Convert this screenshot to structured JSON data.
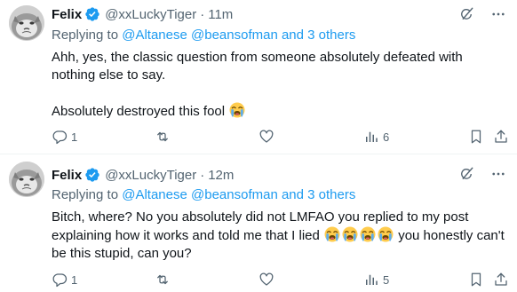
{
  "tweets": [
    {
      "author_name": "Felix",
      "handle": "@xxLuckyTiger",
      "separator": "·",
      "time": "11m",
      "replying_prefix": "Replying to ",
      "replying_user1": "@Altanese",
      "replying_user2": "@beansofman",
      "replying_others": "and 3 others",
      "text_line1": "Ahh, yes, the classic question from someone absolutely defeated with nothing else to say.",
      "text_line2": "Absolutely destroyed this fool",
      "emoji": "loudly-crying-face",
      "reply_count": "1",
      "retweet_count": "",
      "like_count": "",
      "view_count": "6"
    },
    {
      "author_name": "Felix",
      "handle": "@xxLuckyTiger",
      "separator": "·",
      "time": "12m",
      "replying_prefix": "Replying to ",
      "replying_user1": "@Altanese",
      "replying_user2": "@beansofman",
      "replying_others": "and 3 others",
      "text_part1": "Bitch, where? No you absolutely did not LMFAO you replied to my post explaining how it works and told me that I lied",
      "text_part2": "you honestly can't be this stupid, can you?",
      "emoji": "loudly-crying-face",
      "reply_count": "1",
      "retweet_count": "",
      "like_count": "",
      "view_count": "5"
    }
  ],
  "colors": {
    "text": "#0f1419",
    "secondary": "#536471",
    "link": "#1d9bf0",
    "verified": "#1d9bf0"
  }
}
